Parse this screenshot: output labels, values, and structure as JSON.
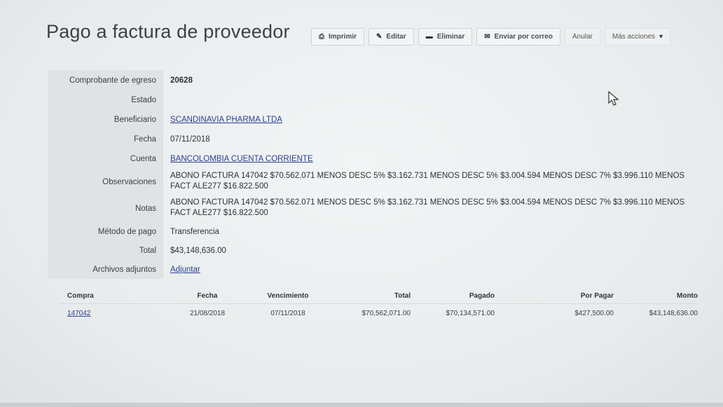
{
  "page": {
    "title": "Pago a factura de proveedor"
  },
  "toolbar": {
    "print": "Imprimir",
    "edit": "Editar",
    "delete": "Eliminar",
    "email": "Enviar por correo",
    "cancel": "Anular",
    "more": "Más acciones"
  },
  "fields": {
    "voucher_label": "Comprobante de egreso",
    "voucher_value": "20628",
    "status_label": "Estado",
    "status_value": "",
    "beneficiary_label": "Beneficiario",
    "beneficiary_value": "SCANDINAVIA PHARMA LTDA",
    "date_label": "Fecha",
    "date_value": "07/11/2018",
    "account_label": "Cuenta",
    "account_value": "BANCOLOMBIA CUENTA CORRIENTE",
    "observations_label": "Observaciones",
    "observations_value": "ABONO FACTURA 147042 $70.562.071 MENOS DESC 5% $3.162.731 MENOS DESC 5% $3.004.594 MENOS DESC 7% $3.996.110 MENOS FACT ALE277 $16.822.500",
    "notes_label": "Notas",
    "notes_value": "ABONO FACTURA 147042 $70.562.071 MENOS DESC 5% $3.162.731 MENOS DESC 5% $3.004.594 MENOS DESC 7% $3.996.110 MENOS FACT ALE277 $16.822.500",
    "payment_method_label": "Método de pago",
    "payment_method_value": "Transferencia",
    "total_label": "Total",
    "total_value": "$43,148,636.00",
    "attachments_label": "Archivos adjuntos",
    "attachments_value": "Adjuntar"
  },
  "table": {
    "headers": {
      "purchase": "Compra",
      "date": "Fecha",
      "due": "Vencimiento",
      "total": "Total",
      "paid": "Pagado",
      "pending": "Por Pagar",
      "amount": "Monto"
    },
    "rows": [
      {
        "purchase": "147042",
        "date": "21/08/2018",
        "due": "07/11/2018",
        "total": "$70,562,071.00",
        "paid": "$70,134,571.00",
        "pending": "$427,500.00",
        "amount": "$43,148,636.00"
      }
    ]
  },
  "icons": {
    "print": "printer-icon",
    "edit": "pencil-icon",
    "delete": "minus-icon",
    "email": "envelope-icon",
    "more": "caret-down-icon"
  },
  "colors": {
    "link": "#2a3f8f",
    "label_bg": "#dfe3e5"
  }
}
